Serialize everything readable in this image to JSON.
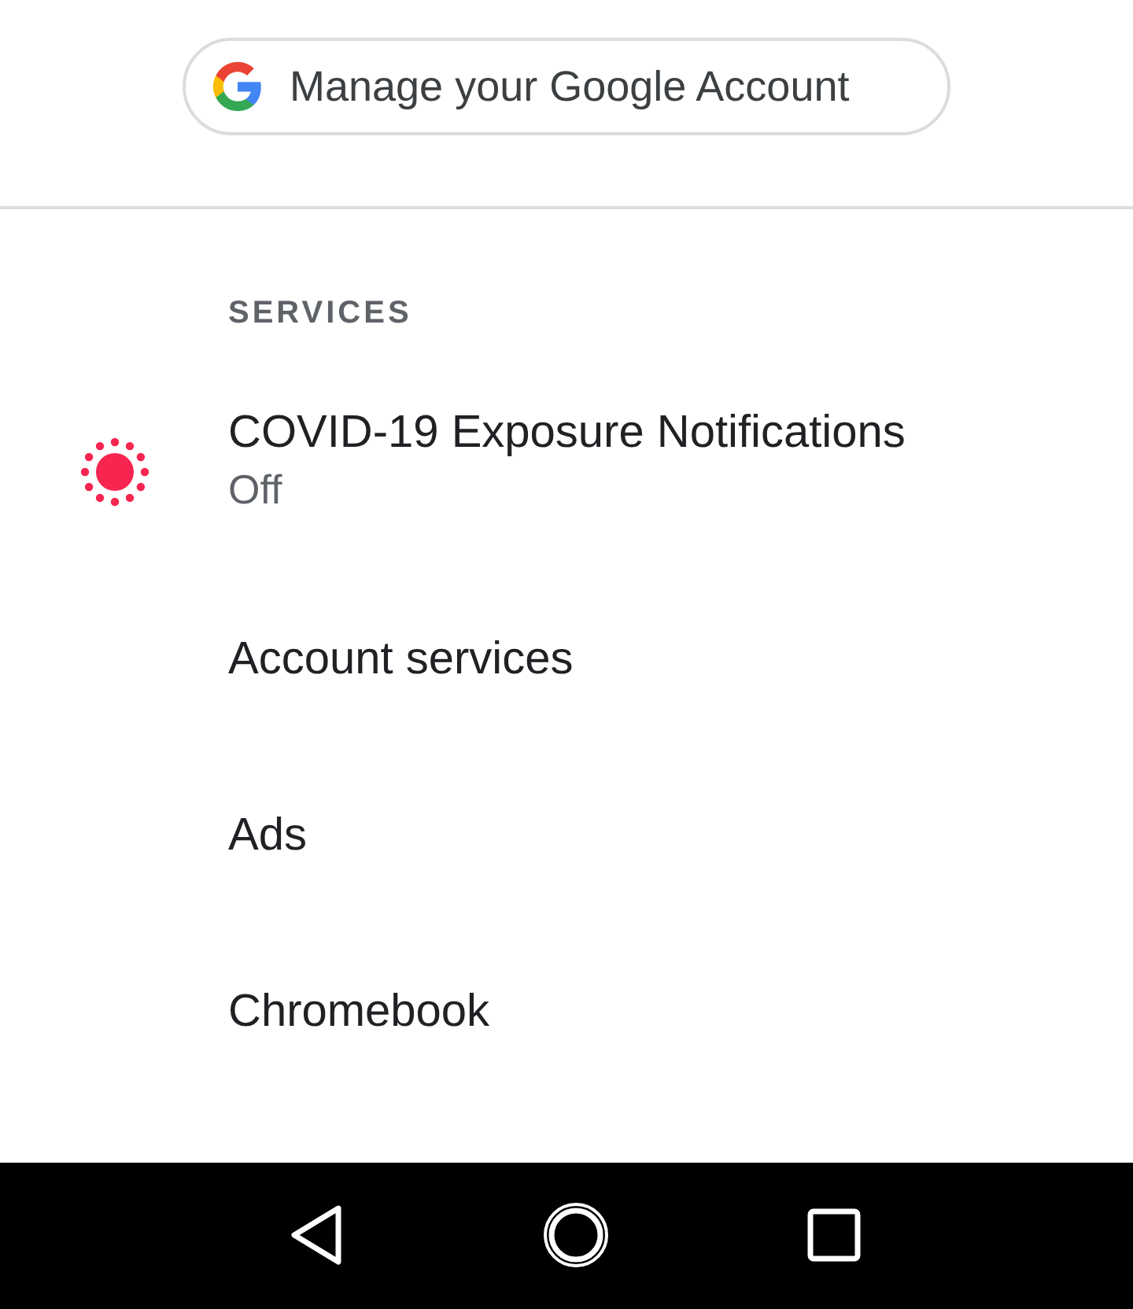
{
  "account_button": {
    "label": "Manage your Google Account"
  },
  "section": {
    "heading": "SERVICES"
  },
  "items": [
    {
      "kind": "status",
      "title": "COVID-19 Exposure Notifications",
      "subtitle": "Off"
    },
    {
      "kind": "plain",
      "title": "Account services"
    },
    {
      "kind": "plain",
      "title": "Ads"
    },
    {
      "kind": "plain",
      "title": "Chromebook"
    }
  ]
}
